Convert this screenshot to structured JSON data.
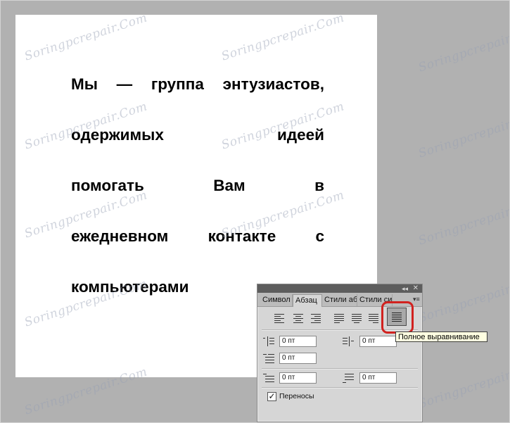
{
  "document": {
    "lines": [
      [
        "Мы",
        "—",
        "группа",
        "энтузиастов,"
      ],
      [
        "одержимых",
        "идеей"
      ],
      [
        "помогать",
        "Вам",
        "в"
      ],
      [
        "ежедневном",
        "контакте",
        "с"
      ],
      [
        "компьютерами"
      ]
    ]
  },
  "watermark": {
    "text": "Soringpcrepair.Com"
  },
  "panel": {
    "tabs": [
      {
        "label": "Символ"
      },
      {
        "label": "Абзац"
      },
      {
        "label": "Стили аб"
      },
      {
        "label": "Стили си"
      }
    ],
    "indent_left": "0 пт",
    "indent_right": "0 пт",
    "indent_first": "0 пт",
    "space_before": "0 пт",
    "space_after": "0 пт",
    "hyphenation_label": "Переносы",
    "hyphenation_checked": "✓",
    "collapse_glyph": "◂◂",
    "close_glyph": "✕",
    "menu_glyph": "▾≡"
  },
  "tooltip": {
    "text": "Полное выравнивание"
  },
  "colors": {
    "highlight": "#d1221f",
    "canvas": "#ffffff",
    "workspace": "#b1b1b1"
  }
}
